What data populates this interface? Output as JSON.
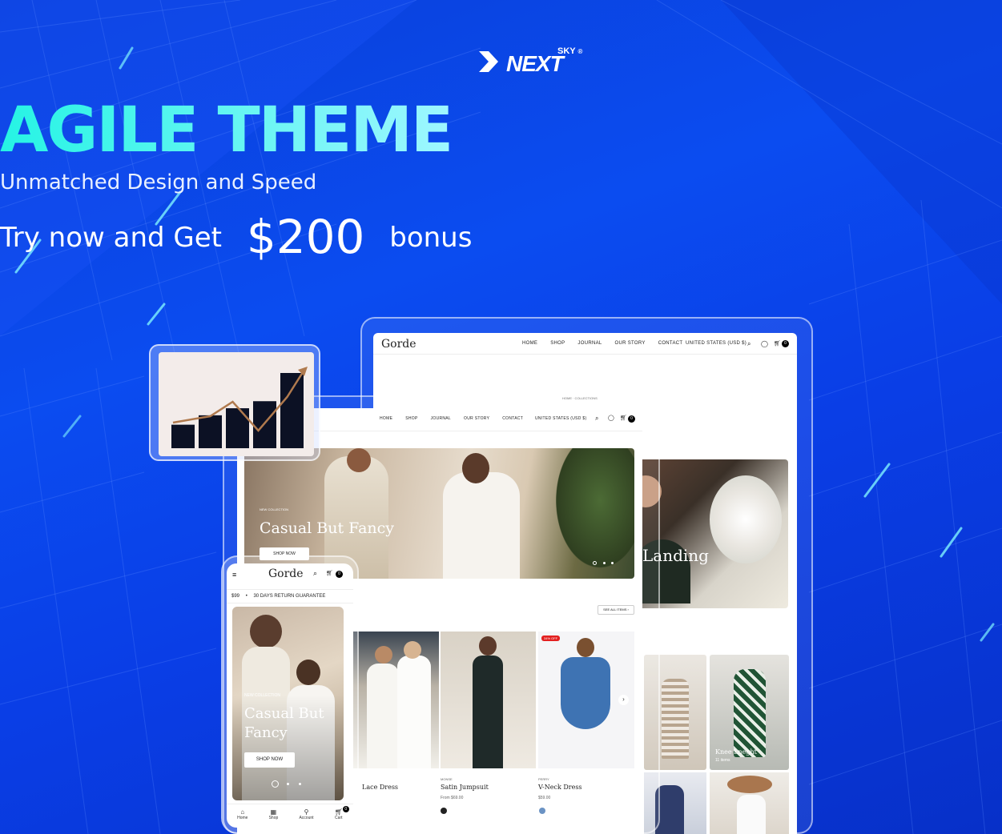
{
  "brand": {
    "logo_main": "NEXT",
    "logo_sup": "SKY",
    "registered": "®"
  },
  "hero": {
    "title": "AGILE THEME",
    "subtitle": "Unmatched Design and Speed",
    "offer_prefix": "Try now and Get",
    "offer_amount": "$200",
    "offer_suffix": "bonus"
  },
  "desktop_back": {
    "store_name": "Gorde",
    "nav": [
      "HOME",
      "SHOP",
      "JOURNAL",
      "OUR STORY",
      "CONTACT"
    ],
    "currency": "UNITED STATES (USD $)",
    "cart_count": "0",
    "breadcrumb": "HOME · COLLECTIONS",
    "hero_partial_text": "Landing",
    "collection_label": "Knee Lneght",
    "collection_count": "11 items"
  },
  "desktop_front": {
    "nav": [
      "HOME",
      "SHOP",
      "JOURNAL",
      "OUR STORY",
      "CONTACT"
    ],
    "currency": "UNITED STATES (USD $)",
    "cart_count": "0",
    "hero_eyebrow": "NEW COLLECTION",
    "hero_title": "Casual But Fancy",
    "hero_button": "SHOP NOW",
    "see_all": "SEE ALL ITEMS",
    "products": [
      {
        "vendor": "",
        "name": "Lace Dress",
        "price": ""
      },
      {
        "vendor": "MONSE",
        "name": "Satin Jumpsuit",
        "price": "From $69.00",
        "swatch": "#222222"
      },
      {
        "vendor": "PERRY",
        "name": "V-Neck Dress",
        "price": "$59.00",
        "swatch": "#6b93c4",
        "badge": "34% OFF"
      }
    ]
  },
  "mobile": {
    "store_name": "Gorde",
    "cart_count": "0",
    "ticker_price": "$99",
    "ticker_text": "30 DAYS RETURN GUARANTEE",
    "hero_eyebrow": "NEW COLLECTION",
    "hero_title": "Casual But Fancy",
    "hero_button": "SHOP NOW",
    "tabbar": [
      "Home",
      "Shop",
      "Account",
      "Cart"
    ]
  },
  "chart_widget": {
    "values": [
      1,
      1.4,
      1.7,
      2,
      3.2
    ],
    "trend_color": "#b07a4e",
    "bar_color": "#0c1124"
  }
}
